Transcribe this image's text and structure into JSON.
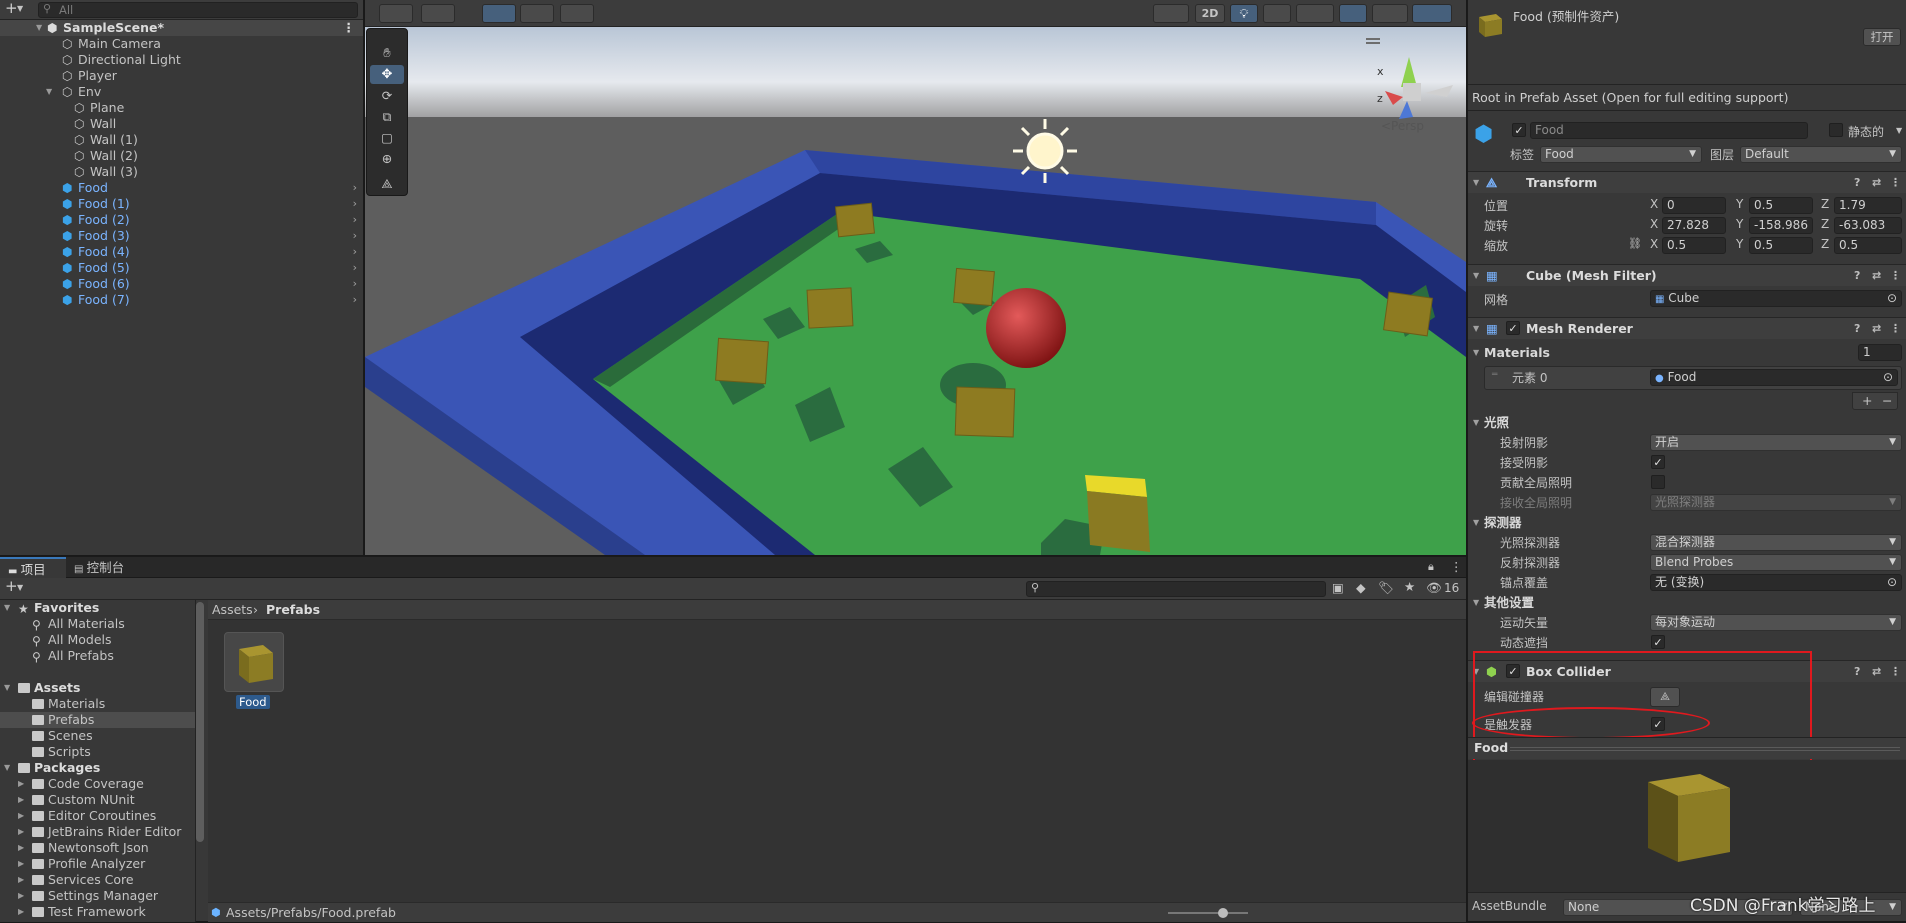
{
  "hierarchy": {
    "search_placeholder": "All",
    "scene_name": "SampleScene*",
    "items": [
      {
        "label": "Main Camera"
      },
      {
        "label": "Directional Light"
      },
      {
        "label": "Player"
      },
      {
        "label": "Env"
      },
      {
        "label": "Plane"
      },
      {
        "label": "Wall"
      },
      {
        "label": "Wall (1)"
      },
      {
        "label": "Wall (2)"
      },
      {
        "label": "Wall (3)"
      },
      {
        "label": "Food"
      },
      {
        "label": "Food (1)"
      },
      {
        "label": "Food (2)"
      },
      {
        "label": "Food (3)"
      },
      {
        "label": "Food (4)"
      },
      {
        "label": "Food (5)"
      },
      {
        "label": "Food (6)"
      },
      {
        "label": "Food (7)"
      }
    ]
  },
  "scene": {
    "mode_2d": "2D",
    "persp_label": "<Persp",
    "gizmo_x": "x",
    "gizmo_z": "z"
  },
  "project": {
    "tabs": [
      {
        "label": "项目"
      },
      {
        "label": "控制台"
      }
    ],
    "hidden_count": "16",
    "tree": {
      "favorites": "Favorites",
      "fav_items": [
        {
          "label": "All Materials"
        },
        {
          "label": "All Models"
        },
        {
          "label": "All Prefabs"
        }
      ],
      "assets": "Assets",
      "asset_folders": [
        {
          "label": "Materials"
        },
        {
          "label": "Prefabs"
        },
        {
          "label": "Scenes"
        },
        {
          "label": "Scripts"
        }
      ],
      "packages": "Packages",
      "package_folders": [
        {
          "label": "Code Coverage"
        },
        {
          "label": "Custom NUnit"
        },
        {
          "label": "Editor Coroutines"
        },
        {
          "label": "JetBrains Rider Editor"
        },
        {
          "label": "Newtonsoft Json"
        },
        {
          "label": "Profile Analyzer"
        },
        {
          "label": "Services Core"
        },
        {
          "label": "Settings Manager"
        },
        {
          "label": "Test Framework"
        }
      ]
    },
    "breadcrumb": [
      "Assets",
      "Prefabs"
    ],
    "asset_name": "Food",
    "status_path": "Assets/Prefabs/Food.prefab"
  },
  "inspector": {
    "title": "Food (预制件资产)",
    "open_button": "打开",
    "root_note": "Root in Prefab Asset (Open for full editing support)",
    "object_name": "Food",
    "static_label": "静态的",
    "tag_label": "标签",
    "tag_value": "Food",
    "layer_label": "图层",
    "layer_value": "Default",
    "transform": {
      "title": "Transform",
      "position_label": "位置",
      "rotation_label": "旋转",
      "scale_label": "缩放",
      "position": {
        "x": "0",
        "y": "0.5",
        "z": "1.79"
      },
      "rotation": {
        "x": "27.828",
        "y": "-158.986",
        "z": "-63.083"
      },
      "scale": {
        "x": "0.5",
        "y": "0.5",
        "z": "0.5"
      }
    },
    "mesh_filter": {
      "title": "Cube (Mesh Filter)",
      "mesh_label": "网格",
      "mesh_value": "Cube"
    },
    "mesh_renderer": {
      "title": "Mesh Renderer",
      "materials_label": "Materials",
      "materials_count": "1",
      "element_label": "元素 0",
      "element_value": "Food",
      "lighting_section": "光照",
      "cast_shadows_label": "投射阴影",
      "cast_shadows_value": "开启",
      "receive_shadows_label": "接受阴影",
      "contribute_gi_label": "贡献全局照明",
      "receive_gi_label": "接收全局照明",
      "receive_gi_value": "光照探测器",
      "probes_section": "探测器",
      "light_probes_label": "光照探测器",
      "light_probes_value": "混合探测器",
      "reflection_probes_label": "反射探测器",
      "reflection_probes_value": "Blend Probes",
      "anchor_label": "锚点覆盖",
      "anchor_value": "无 (变换)",
      "other_section": "其他设置",
      "motion_vectors_label": "运动矢量",
      "motion_vectors_value": "每对象运动",
      "dynamic_occlusion_label": "动态遮挡"
    },
    "box_collider": {
      "title": "Box Collider",
      "edit_collider_label": "编辑碰撞器",
      "is_trigger_label": "是触发器"
    },
    "preview_title": "Food",
    "assetbundle_label": "AssetBundle",
    "assetbundle_value": "None",
    "assetbundle_variant": "None"
  },
  "watermark": "CSDN @Frank学习路上",
  "colors": {
    "accent": "#3a79bb",
    "prefab_text": "#7ab4ff",
    "highlight": "#e0191e",
    "field_bg": "#2a2a2a"
  }
}
